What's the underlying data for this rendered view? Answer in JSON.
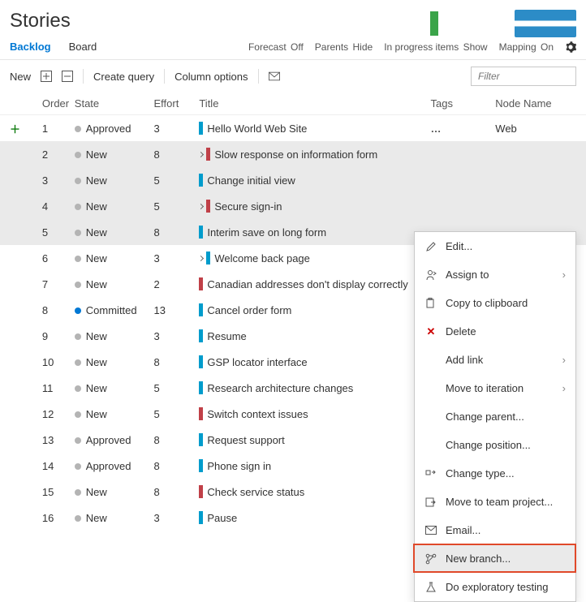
{
  "header": {
    "title": "Stories"
  },
  "subnav": {
    "backlog": "Backlog",
    "board": "Board",
    "forecast_label": "Forecast",
    "forecast_value": "Off",
    "parents_label": "Parents",
    "parents_value": "Hide",
    "inprogress_label": "In progress items",
    "inprogress_value": "Show",
    "mapping_label": "Mapping",
    "mapping_value": "On"
  },
  "toolbar": {
    "new": "New",
    "create_query": "Create query",
    "column_options": "Column options",
    "filter_placeholder": "Filter"
  },
  "columns": {
    "order": "Order",
    "state": "State",
    "effort": "Effort",
    "title": "Title",
    "tags": "Tags",
    "node_name": "Node Name"
  },
  "rows": [
    {
      "order": "1",
      "state": "Approved",
      "effort": "3",
      "title": "Hello World Web Site",
      "bar": "blue",
      "chev": false,
      "node": "Web",
      "plus": true,
      "sel": false,
      "ellipsis": true
    },
    {
      "order": "2",
      "state": "New",
      "effort": "8",
      "title": "Slow response on information form",
      "bar": "red",
      "chev": true,
      "sel": true
    },
    {
      "order": "3",
      "state": "New",
      "effort": "5",
      "title": "Change initial view",
      "bar": "blue",
      "chev": false,
      "sel": true
    },
    {
      "order": "4",
      "state": "New",
      "effort": "5",
      "title": "Secure sign-in",
      "bar": "red",
      "chev": true,
      "sel": true
    },
    {
      "order": "5",
      "state": "New",
      "effort": "8",
      "title": "Interim save on long form",
      "bar": "blue",
      "chev": false,
      "sel": true
    },
    {
      "order": "6",
      "state": "New",
      "effort": "3",
      "title": "Welcome back page",
      "bar": "blue",
      "chev": true,
      "sel": false
    },
    {
      "order": "7",
      "state": "New",
      "effort": "2",
      "title": "Canadian addresses don't display correctly",
      "bar": "red",
      "chev": false,
      "sel": false
    },
    {
      "order": "8",
      "state": "Committed",
      "effort": "13",
      "title": "Cancel order form",
      "bar": "blue",
      "chev": false,
      "sel": false
    },
    {
      "order": "9",
      "state": "New",
      "effort": "3",
      "title": "Resume",
      "bar": "blue",
      "chev": false,
      "sel": false
    },
    {
      "order": "10",
      "state": "New",
      "effort": "8",
      "title": "GSP locator interface",
      "bar": "blue",
      "chev": false,
      "sel": false
    },
    {
      "order": "11",
      "state": "New",
      "effort": "5",
      "title": "Research architecture changes",
      "bar": "blue",
      "chev": false,
      "sel": false
    },
    {
      "order": "12",
      "state": "New",
      "effort": "5",
      "title": "Switch context issues",
      "bar": "red",
      "chev": false,
      "sel": false
    },
    {
      "order": "13",
      "state": "Approved",
      "effort": "8",
      "title": "Request support",
      "bar": "blue",
      "chev": false,
      "sel": false
    },
    {
      "order": "14",
      "state": "Approved",
      "effort": "8",
      "title": "Phone sign in",
      "bar": "blue",
      "chev": false,
      "sel": false
    },
    {
      "order": "15",
      "state": "New",
      "effort": "8",
      "title": "Check service status",
      "bar": "red",
      "chev": false,
      "sel": false
    },
    {
      "order": "16",
      "state": "New",
      "effort": "3",
      "title": "Pause",
      "bar": "blue",
      "chev": false,
      "sel": false
    }
  ],
  "menu": {
    "edit": "Edit...",
    "assign_to": "Assign to",
    "copy": "Copy to clipboard",
    "delete": "Delete",
    "add_link": "Add link",
    "move_iter": "Move to iteration",
    "change_parent": "Change parent...",
    "change_position": "Change position...",
    "change_type": "Change type...",
    "move_team": "Move to team project...",
    "email": "Email...",
    "new_branch": "New branch...",
    "exploratory": "Do exploratory testing"
  }
}
